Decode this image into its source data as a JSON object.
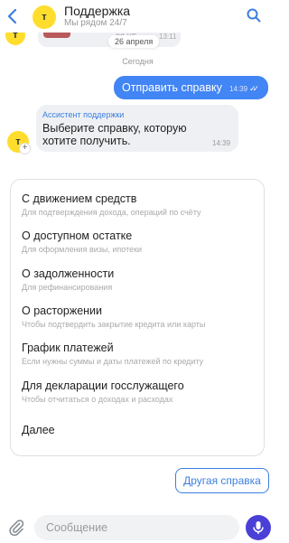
{
  "header": {
    "title": "Поддержка",
    "subtitle": "Мы рядом 24/7",
    "logo_letter": "т"
  },
  "prev_message": {
    "file_size": "32 КБ",
    "time": "13:11"
  },
  "date_chip": "26 апреля",
  "divider_today": "Сегодня",
  "sent_message": {
    "text": "Отправить справку",
    "time": "14:39",
    "status_icon": "double-check-icon"
  },
  "assistant_message": {
    "sender": "Ассистент поддержки",
    "text": "Выберите справку, которую хотите получить.",
    "time": "14:39"
  },
  "options": [
    {
      "title": "С движением средств",
      "subtitle": "Для подтверждения дохода, операций по счёту"
    },
    {
      "title": "О доступном остатке",
      "subtitle": "Для оформления визы, ипотеки"
    },
    {
      "title": "О задолженности",
      "subtitle": "Для рефинансирования"
    },
    {
      "title": "О расторжении",
      "subtitle": "Чтобы подтвердить закрытие кредита или карты"
    },
    {
      "title": "График платежей",
      "subtitle": "Если нужны суммы и даты платежей по кредиту"
    },
    {
      "title": "Для декларации госслужащего",
      "subtitle": "Чтобы отчитаться о доходах и расходах"
    },
    {
      "title": "Далее",
      "subtitle": ""
    }
  ],
  "other_button": "Другая справка",
  "composer": {
    "placeholder": "Сообщение"
  },
  "colors": {
    "accent_blue": "#4285f4",
    "brand_yellow": "#ffdd2d",
    "mic_purple": "#4a3fd6"
  }
}
